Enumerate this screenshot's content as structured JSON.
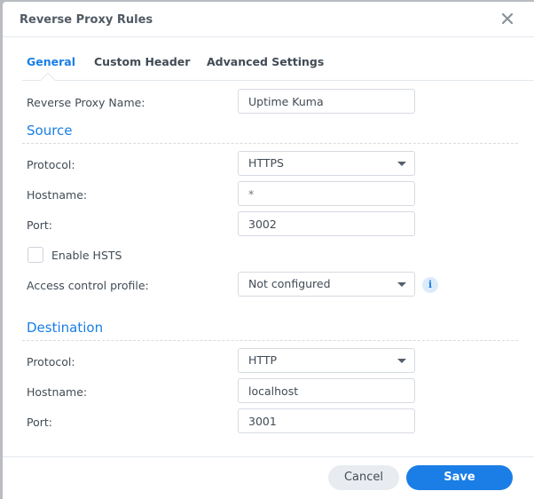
{
  "dialog": {
    "title": "Reverse Proxy Rules",
    "close_icon": "close-icon"
  },
  "tabs": [
    {
      "label": "General",
      "active": true
    },
    {
      "label": "Custom Header",
      "active": false
    },
    {
      "label": "Advanced Settings",
      "active": false
    }
  ],
  "general": {
    "name_label": "Reverse Proxy Name:",
    "name_value": "Uptime Kuma"
  },
  "source": {
    "heading": "Source",
    "protocol_label": "Protocol:",
    "protocol_value": "HTTPS",
    "hostname_label": "Hostname:",
    "hostname_value": "",
    "hostname_placeholder": "*",
    "port_label": "Port:",
    "port_value": "3002",
    "hsts_label": "Enable HSTS",
    "hsts_checked": false,
    "access_label": "Access control profile:",
    "access_value": "Not configured",
    "info_icon": "i"
  },
  "destination": {
    "heading": "Destination",
    "protocol_label": "Protocol:",
    "protocol_value": "HTTP",
    "hostname_label": "Hostname:",
    "hostname_value": "localhost",
    "port_label": "Port:",
    "port_value": "3001"
  },
  "footer": {
    "cancel_label": "Cancel",
    "save_label": "Save"
  },
  "colors": {
    "accent": "#1a7ee6",
    "text": "#414b55"
  }
}
